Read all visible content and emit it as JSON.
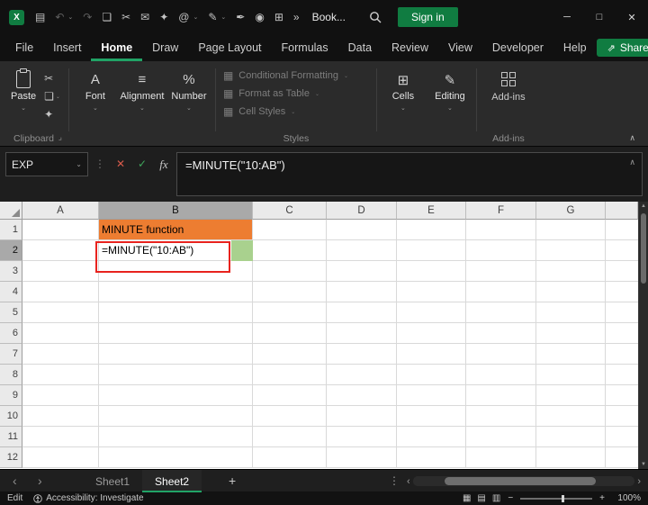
{
  "ui": {
    "caret_glyph": "⌄",
    "styles_glyph": "▦"
  },
  "colors": {
    "accent_green": "#107C41",
    "tab_underline": "#21A366",
    "cell_orange": "#ED7D31",
    "cell_green": "#A9D18E",
    "annotation_red": "#E8231E",
    "cancel_red": "#D65A4A",
    "enter_green": "#3FA65C"
  },
  "titlebar": {
    "logo_letter": "X",
    "title": "Book...",
    "signin_label": "Sign in",
    "quick_icons": [
      {
        "name": "app-menu-icon",
        "glyph": "▤"
      },
      {
        "name": "undo-icon",
        "glyph": "↶",
        "dim": true,
        "caret": true
      },
      {
        "name": "redo-icon",
        "glyph": "↷",
        "dim": true
      },
      {
        "name": "copy-icon",
        "glyph": "❏"
      },
      {
        "name": "cut-icon",
        "glyph": "✂"
      },
      {
        "name": "mail-icon",
        "glyph": "✉"
      },
      {
        "name": "format-painter-icon",
        "glyph": "✦"
      },
      {
        "name": "at-mention-icon",
        "glyph": "@",
        "caret": true
      },
      {
        "name": "pen-icon",
        "glyph": "✎",
        "caret": true
      },
      {
        "name": "signature-icon",
        "glyph": "✒"
      },
      {
        "name": "camera-icon",
        "glyph": "◉"
      },
      {
        "name": "table-icon",
        "glyph": "⊞"
      },
      {
        "name": "overflow-icon",
        "glyph": "»"
      }
    ],
    "window_controls": [
      {
        "name": "minimize-button",
        "glyph": "─"
      },
      {
        "name": "maximize-button",
        "glyph": "□"
      },
      {
        "name": "close-button",
        "glyph": "✕"
      }
    ]
  },
  "menubar": {
    "tabs": [
      "File",
      "Insert",
      "Home",
      "Draw",
      "Page Layout",
      "Formulas",
      "Data",
      "Review",
      "View",
      "Developer",
      "Help"
    ],
    "active_tab": "Home",
    "share_label": "Share",
    "share_icon_glyph": "⇗"
  },
  "ribbon": {
    "paste_label": "Paste",
    "clipboard_icons": [
      {
        "name": "cut-icon",
        "glyph": "✂"
      },
      {
        "name": "copy-icon",
        "glyph": "❏",
        "caret": true
      },
      {
        "name": "format-painter-icon",
        "glyph": "✦"
      }
    ],
    "big_buttons_left": [
      {
        "name": "font-button",
        "icon": "A",
        "label": "Font"
      },
      {
        "name": "alignment-button",
        "icon": "≡",
        "label": "Alignment"
      },
      {
        "name": "number-button",
        "icon": "%",
        "label": "Number"
      }
    ],
    "styles_items": [
      {
        "label": "Conditional Formatting",
        "icon_name": "conditional-formatting-icon"
      },
      {
        "label": "Format as Table",
        "icon_name": "format-as-table-icon"
      },
      {
        "label": "Cell Styles",
        "icon_name": "cell-styles-icon"
      }
    ],
    "big_buttons_right": [
      {
        "name": "cells-button",
        "icon": "⊞",
        "label": "Cells"
      },
      {
        "name": "editing-button",
        "icon": "✎",
        "label": "Editing"
      }
    ],
    "addins_label": "Add-ins",
    "group_labels": {
      "clipboard": "Clipboard",
      "styles": "Styles",
      "addins": "Add-ins"
    },
    "launcher_glyph": "⌟",
    "collapse_glyph": "∧"
  },
  "formula_bar": {
    "name_box": "EXP",
    "dots_glyph": "⋮",
    "cancel_glyph": "✕",
    "enter_glyph": "✓",
    "fx_label": "fx",
    "formula": "=MINUTE(\"10:AB\")",
    "collapse_glyph": "∧"
  },
  "grid": {
    "columns": [
      "A",
      "B",
      "C",
      "D",
      "E",
      "F",
      "G"
    ],
    "rows": [
      1,
      2,
      3,
      4,
      5,
      6,
      7,
      8,
      9,
      10,
      11,
      12
    ],
    "selected_column": "B",
    "selected_row": 2,
    "cells": {
      "B1": {
        "text": "MINUTE function",
        "bg": "#ED7D31"
      },
      "B2": {
        "text": "=MINUTE(\"10:AB\")"
      }
    }
  },
  "sheetbar": {
    "nav_left": "‹",
    "nav_right": "›",
    "sheets": [
      {
        "label": "Sheet1",
        "active": false
      },
      {
        "label": "Sheet2",
        "active": true
      }
    ],
    "add_glyph": "+",
    "menu_glyph": "⋮"
  },
  "statusbar": {
    "mode": "Edit",
    "accessibility": "Accessibility: Investigate",
    "view_icons": [
      {
        "name": "normal-view-icon",
        "glyph": "▦"
      },
      {
        "name": "page-layout-view-icon",
        "glyph": "▤"
      },
      {
        "name": "page-break-view-icon",
        "glyph": "▥"
      }
    ],
    "zoom_out": "−",
    "zoom_in": "+",
    "zoom": "100%"
  }
}
